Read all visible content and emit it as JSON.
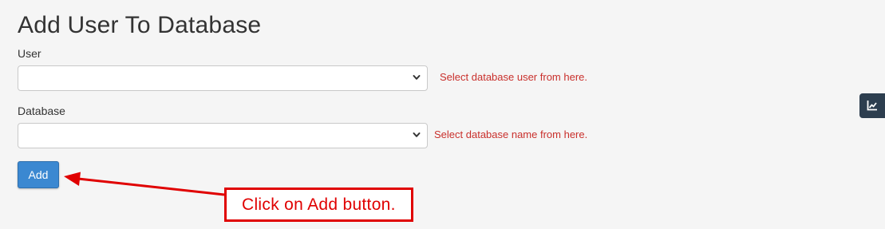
{
  "page": {
    "title": "Add User To Database"
  },
  "form": {
    "user": {
      "label": "User",
      "selected_value": "",
      "hint": "Select database user from here."
    },
    "database": {
      "label": "Database",
      "selected_value": "",
      "hint": "Select database name from here."
    },
    "add_label": "Add"
  },
  "annotation": {
    "text": "Click on Add button."
  },
  "side_widget": {
    "icon": "chart-line-icon"
  },
  "colors": {
    "page_background": "#f5f5f5",
    "primary_button": "#3b88d1",
    "hint_text": "#c9302c",
    "annotation": "#e00000",
    "side_widget": "#2d3e4f"
  }
}
